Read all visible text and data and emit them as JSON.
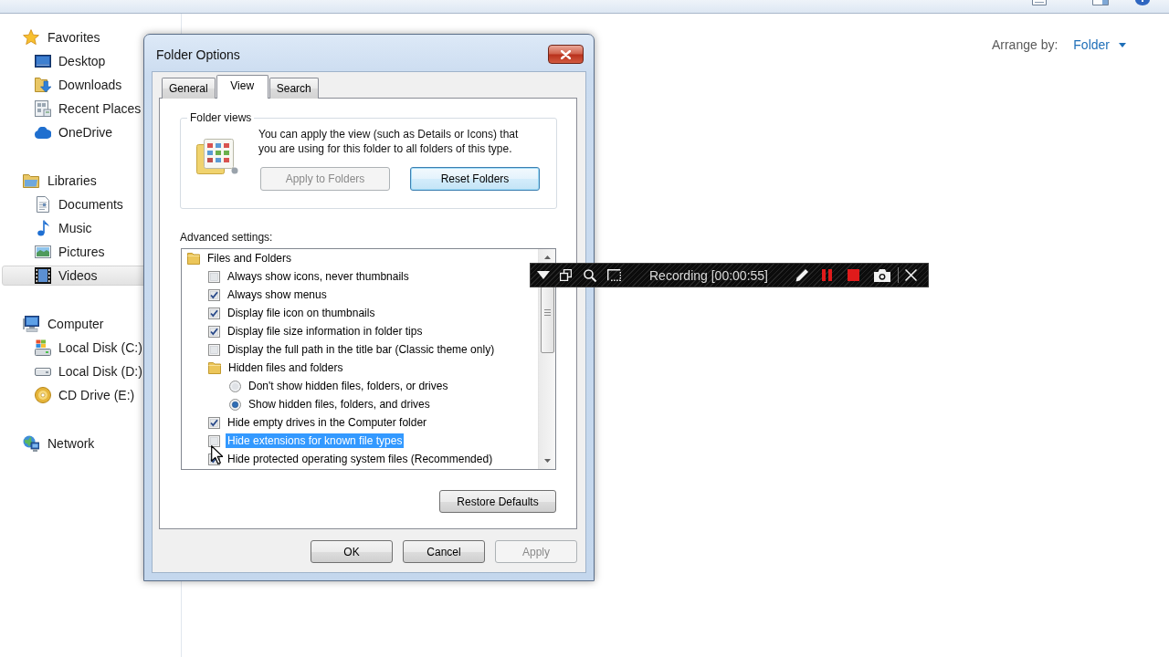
{
  "explorer": {
    "sidebar": {
      "groups": [
        {
          "label": "Favorites",
          "selected": false,
          "items": [
            {
              "label": "Desktop",
              "selected": false
            },
            {
              "label": "Downloads",
              "selected": false
            },
            {
              "label": "Recent Places",
              "selected": false
            },
            {
              "label": "OneDrive",
              "selected": false
            }
          ]
        },
        {
          "label": "Libraries",
          "selected": false,
          "items": [
            {
              "label": "Documents",
              "selected": false
            },
            {
              "label": "Music",
              "selected": false
            },
            {
              "label": "Pictures",
              "selected": false
            },
            {
              "label": "Videos",
              "selected": true
            }
          ]
        },
        {
          "label": "Computer",
          "selected": false,
          "items": [
            {
              "label": "Local Disk (C:)",
              "selected": false
            },
            {
              "label": "Local Disk (D:)",
              "selected": false
            },
            {
              "label": "CD Drive (E:)",
              "selected": false
            }
          ]
        },
        {
          "label": "Network",
          "selected": false
        }
      ]
    },
    "arrange": {
      "label": "Arrange by:",
      "value": "Folder"
    }
  },
  "dialog": {
    "title": "Folder Options",
    "tabs": [
      {
        "label": "General",
        "selected": false
      },
      {
        "label": "View",
        "selected": true
      },
      {
        "label": "Search",
        "selected": false
      }
    ],
    "folder_views": {
      "title": "Folder views",
      "text": "You can apply the view (such as Details or Icons) that you are using for this folder to all folders of this type.",
      "buttons": [
        {
          "label": "Apply to Folders",
          "disabled": true,
          "default": false
        },
        {
          "label": "Reset Folders",
          "disabled": false,
          "default": true
        }
      ]
    },
    "advanced": {
      "label": "Advanced settings:",
      "items": [
        {
          "kind": "folder",
          "label": "Files and Folders",
          "selected": false,
          "children": [
            {
              "kind": "checkbox",
              "label": "Always show icons, never thumbnails",
              "checked": false,
              "selected": false
            },
            {
              "kind": "checkbox",
              "label": "Always show menus",
              "checked": true,
              "selected": false
            },
            {
              "kind": "checkbox",
              "label": "Display file icon on thumbnails",
              "checked": true,
              "selected": false
            },
            {
              "kind": "checkbox",
              "label": "Display file size information in folder tips",
              "checked": true,
              "selected": false
            },
            {
              "kind": "checkbox",
              "label": "Display the full path in the title bar (Classic theme only)",
              "checked": false,
              "selected": false
            },
            {
              "kind": "folder",
              "label": "Hidden files and folders",
              "selected": false,
              "children": [
                {
                  "kind": "radio",
                  "label": "Don't show hidden files, folders, or drives",
                  "checked": false,
                  "selected": false
                },
                {
                  "kind": "radio",
                  "label": "Show hidden files, folders, and drives",
                  "checked": true,
                  "selected": false
                }
              ]
            },
            {
              "kind": "checkbox",
              "label": "Hide empty drives in the Computer folder",
              "checked": true,
              "selected": false
            },
            {
              "kind": "checkbox",
              "label": "Hide extensions for known file types",
              "checked": false,
              "selected": true
            },
            {
              "kind": "checkbox",
              "label": "Hide protected operating system files (Recommended)",
              "checked": true,
              "selected": false
            }
          ]
        }
      ]
    },
    "restore_defaults": "Restore Defaults",
    "buttons": [
      {
        "label": "OK",
        "disabled": false
      },
      {
        "label": "Cancel",
        "disabled": false
      },
      {
        "label": "Apply",
        "disabled": true
      }
    ]
  },
  "recording_bar": {
    "status": "Recording [00:00:55]"
  }
}
